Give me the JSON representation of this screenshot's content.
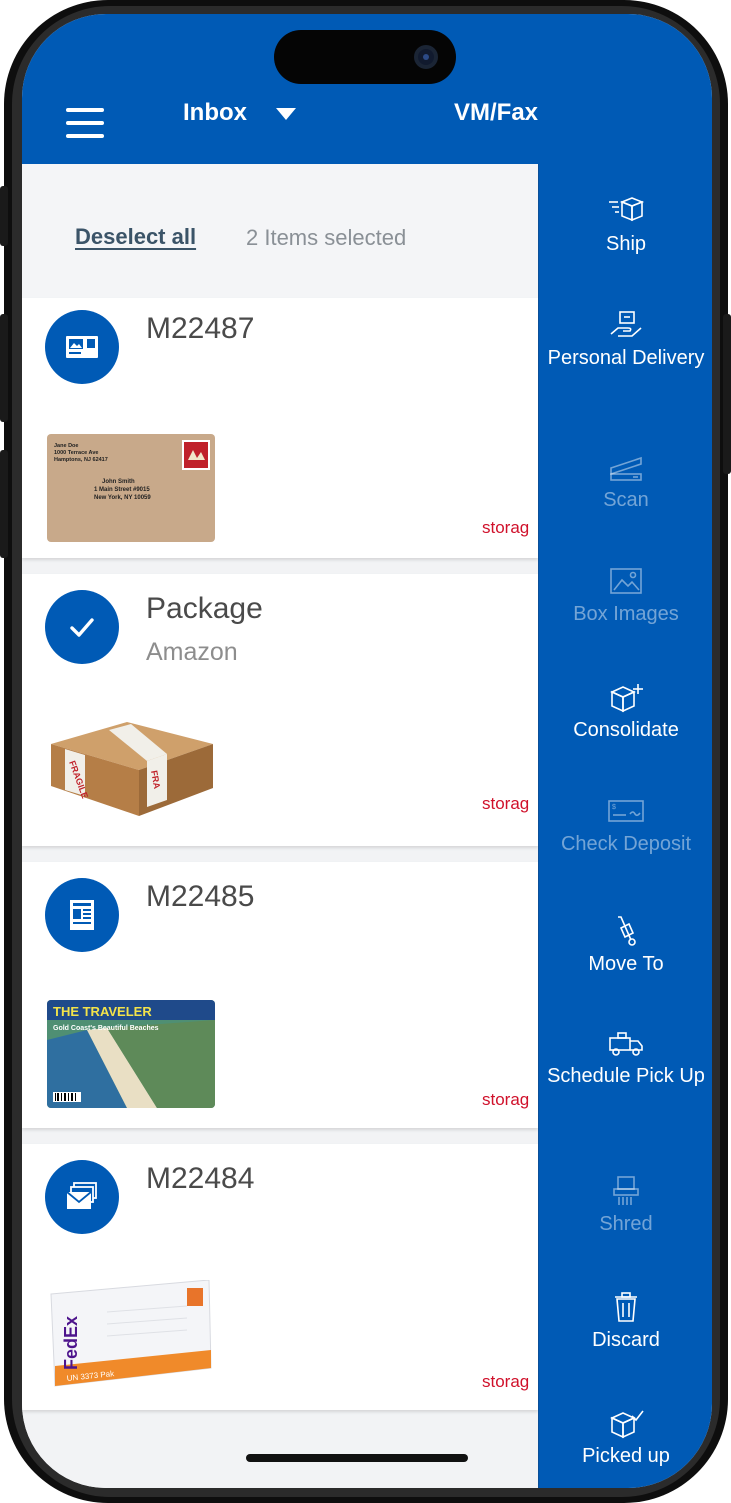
{
  "header": {
    "menu_icon": "hamburger-menu-icon",
    "tab_inbox": "Inbox",
    "tab_vmfax": "VM/Fax",
    "dropdown_icon": "caret-down-icon",
    "color": "#005ab5"
  },
  "selection_bar": {
    "deselect_label": "Deselect all",
    "count_text": "2 Items selected"
  },
  "items": [
    {
      "title": "M22487",
      "subtitle": "",
      "icon": "letter-icon",
      "thumbnail": "envelope-image",
      "storage": "storag",
      "selected": false
    },
    {
      "title": "Package",
      "subtitle": "Amazon",
      "icon": "checkmark-icon",
      "thumbnail": "package-image",
      "storage": "storag",
      "selected": true
    },
    {
      "title": "M22485",
      "subtitle": "",
      "icon": "magazine-icon",
      "thumbnail": "magazine-image",
      "storage": "storag",
      "selected": false
    },
    {
      "title": "M22484",
      "subtitle": "",
      "icon": "stacked-mail-icon",
      "thumbnail": "fedex-envelope-image",
      "storage": "storag",
      "selected": false
    }
  ],
  "thumbnails": {
    "envelope": {
      "from_name": "Jane Doe",
      "from_street": "1000 Terrace Ave",
      "from_city": "Hamptons, NJ 62417",
      "to_name": "John Smith",
      "to_street": "1 Main Street #9015",
      "to_city": "New York, NY 10059"
    },
    "package": {
      "label": "FRAGILE"
    },
    "magazine": {
      "masthead": "THE TRAVELER",
      "headline": "Gold Coast's Beautiful Beaches"
    },
    "fedex": {
      "logo": "FedEx",
      "ref": "UN 3373 Pak"
    }
  },
  "actions": [
    {
      "label": "Ship",
      "icon": "ship-box-icon",
      "enabled": true
    },
    {
      "label": "Personal Delivery",
      "icon": "hand-delivery-icon",
      "enabled": true
    },
    {
      "label": "Scan",
      "icon": "scanner-icon",
      "enabled": false
    },
    {
      "label": "Box Images",
      "icon": "image-icon",
      "enabled": false
    },
    {
      "label": "Consolidate",
      "icon": "consolidate-box-icon",
      "enabled": true
    },
    {
      "label": "Check Deposit",
      "icon": "check-icon",
      "enabled": false
    },
    {
      "label": "Move To",
      "icon": "hand-truck-icon",
      "enabled": true
    },
    {
      "label": "Schedule Pick Up",
      "icon": "truck-icon",
      "enabled": true
    },
    {
      "label": "Shred",
      "icon": "shredder-icon",
      "enabled": false
    },
    {
      "label": "Discard",
      "icon": "trash-icon",
      "enabled": true
    },
    {
      "label": "Picked up",
      "icon": "picked-up-box-icon",
      "enabled": true
    }
  ]
}
